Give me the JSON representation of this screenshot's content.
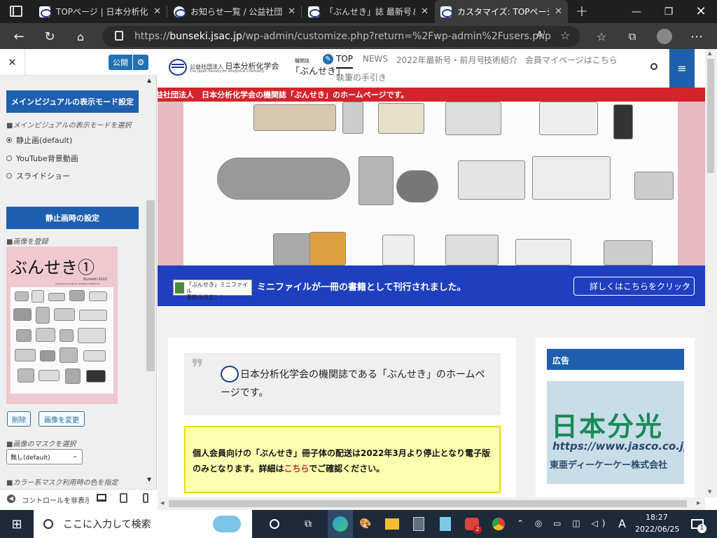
{
  "browser": {
    "tabs": [
      {
        "title": "TOPページ | 日本分析化学",
        "icon": "jsac-logo-icon"
      },
      {
        "title": "お知らせ一覧 / 公益社団",
        "icon": "site-icon"
      },
      {
        "title": "「ぶんせき」誌 最新号＆ア",
        "icon": "jsac-logo-icon"
      },
      {
        "title": "カスタマイズ: TOPページ | ",
        "icon": "jsac-logo-icon",
        "active": true
      }
    ],
    "url_prefix": "https://",
    "url_domain": "bunseki.jsac.jp",
    "url_path": "/wp-admin/customize.php?return=%2Fwp-admin%2Fusers.php"
  },
  "customizer": {
    "close_label": "✕",
    "publish_label": "公開",
    "section_main_visual": "メインビジュアルの表示モード設定",
    "mode_label": "■メインビジュアルの表示モードを選択",
    "modes": [
      {
        "label": "静止画(default)",
        "selected": true
      },
      {
        "label": "YouTube背景動画",
        "selected": false
      },
      {
        "label": "スライドショー",
        "selected": false
      }
    ],
    "section_still": "静止画時の設定",
    "image_label": "■画像を登録",
    "thumb_title": "ぶんせき①",
    "thumb_sub1": "Bunseki 2022",
    "thumb_sub2": "The Japan Society for Analytical Chemistry",
    "delete_label": "削除",
    "change_label": "画像を変更",
    "mask_label": "■画像のマスクを選択",
    "mask_value": "無し(default)",
    "color_mask_label": "■カラー系マスク利用時の色を指定",
    "hide_controls_label": "コントロールを非表示"
  },
  "site": {
    "logo_sub": "公益社団法人",
    "logo_main": "日本分析化学会",
    "logo_en": "The Japan Society for Analytical Chemistry",
    "logo_mag_small": "機関誌",
    "logo_mag": "「ぶんせき」",
    "nav": [
      "TOP",
      "NEWS",
      "2022年最新号・前月号",
      "技術紹介",
      "会員マイページはこちら",
      "執筆の手引き"
    ],
    "red_bar_text": "公益社団法人　日本分析化学会の機関誌「ぶんせき」のホームページです。",
    "banner_badge_line1": "「ぶんせき」ミニファイル",
    "banner_badge_line2": "書籍化決定！！",
    "banner_text": "ミニファイルが一冊の書籍として刊行されました。",
    "banner_button": "詳しくはこちらをクリック",
    "quote_text": "日本分析化学会の機関誌である「ぶんせき」のホームページです。",
    "notice_text_1": "個人会員向けの「ぶんせき」冊子体の配送は2022年3月より停止となり電子版のみとなります。詳細は",
    "notice_link": "こちら",
    "notice_text_2": "でご確認ください。",
    "ad_heading": "広告",
    "ad_company": "日本分光",
    "ad_url": "https://www.jasco.co.jp",
    "ad_company_2": "東亜ディーケーケー株式会社"
  },
  "taskbar": {
    "search_placeholder": "ここに入力して検索",
    "time": "18:27",
    "date": "2022/06/25",
    "ime": "A",
    "notify_count": "1",
    "chat_badge": "2"
  },
  "colors": {
    "accent": "#1e5fae",
    "red_bar": "#d4232b",
    "banner": "#1e3fbf",
    "notice_border": "#e8dc00",
    "notice_bg": "#ffffb0"
  }
}
